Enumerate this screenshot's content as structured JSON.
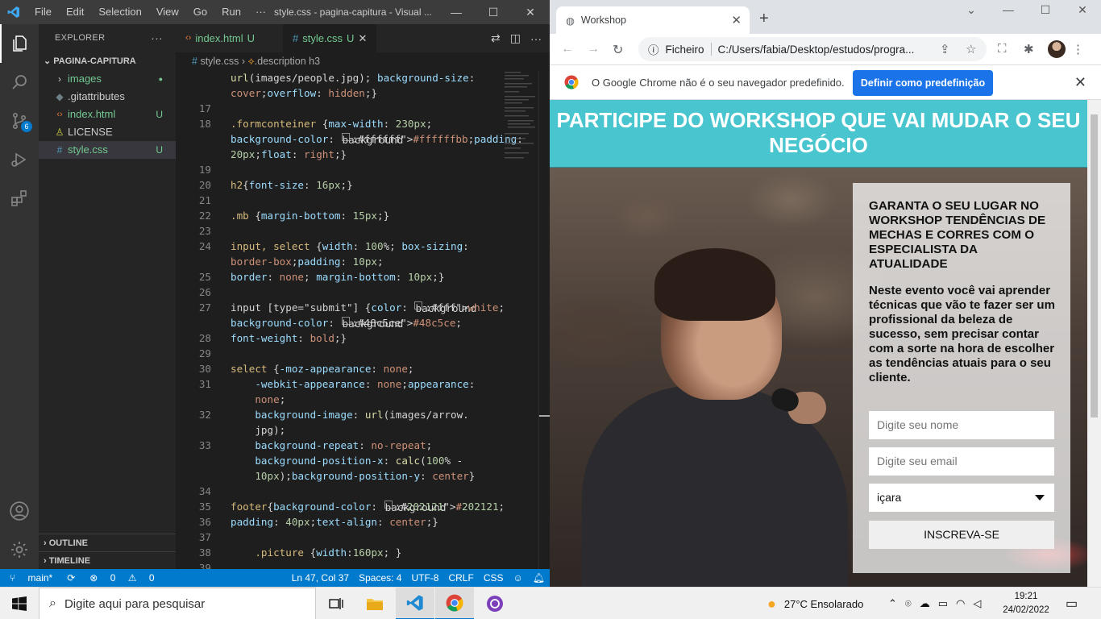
{
  "vscode": {
    "menu": [
      "File",
      "Edit",
      "Selection",
      "View",
      "Go",
      "Run",
      "···"
    ],
    "window_title": "style.css - pagina-capitura - Visual ...",
    "explorer": {
      "header": "EXPLORER",
      "folder": "PAGINA-CAPITURA",
      "items": [
        {
          "icon": "chevron-right",
          "label": "images",
          "status": "●"
        },
        {
          "icon": "gitattributes",
          "label": ".gitattributes",
          "status": ""
        },
        {
          "icon": "html",
          "label": "index.html",
          "status": "U"
        },
        {
          "icon": "license",
          "label": "LICENSE",
          "status": ""
        },
        {
          "icon": "css",
          "label": "style.css",
          "status": "U"
        }
      ],
      "outline": "OUTLINE",
      "timeline": "TIMELINE"
    },
    "scm_badge": "6",
    "tabs": [
      {
        "label": "index.html",
        "status": "U"
      },
      {
        "label": "style.css",
        "status": "U"
      }
    ],
    "breadcrumb": {
      "file": "style.css",
      "symbol": ".description h3"
    },
    "code_lines": [
      {
        "n": "",
        "text": "url(images/people.jpg); background-size:"
      },
      {
        "n": "",
        "text": "cover;overflow: hidden;}"
      },
      {
        "n": "17",
        "text": ""
      },
      {
        "n": "18",
        "text": ".formconteiner {max-width: 230px;"
      },
      {
        "n": "",
        "text": "background-color: #ffffffbb;padding:"
      },
      {
        "n": "",
        "text": "20px;float: right;}"
      },
      {
        "n": "19",
        "text": ""
      },
      {
        "n": "20",
        "text": "h2{font-size: 16px;}"
      },
      {
        "n": "21",
        "text": ""
      },
      {
        "n": "22",
        "text": ".mb {margin-bottom: 15px;}"
      },
      {
        "n": "23",
        "text": ""
      },
      {
        "n": "24",
        "text": "input, select {width: 100%; box-sizing:"
      },
      {
        "n": "",
        "text": "border-box;padding: 10px;"
      },
      {
        "n": "25",
        "text": "border: none; margin-bottom: 10px;}"
      },
      {
        "n": "26",
        "text": ""
      },
      {
        "n": "27",
        "text": "input [type=\"submit\"] {color: white;"
      },
      {
        "n": "",
        "text": "background-color: #48c5ce;"
      },
      {
        "n": "28",
        "text": "font-weight: bold;}"
      },
      {
        "n": "29",
        "text": ""
      },
      {
        "n": "30",
        "text": "select {-moz-appearance: none;"
      },
      {
        "n": "31",
        "text": "    -webkit-appearance: none;appearance:"
      },
      {
        "n": "",
        "text": "    none;"
      },
      {
        "n": "32",
        "text": "    background-image: url(images/arrow."
      },
      {
        "n": "",
        "text": "    jpg);"
      },
      {
        "n": "33",
        "text": "    background-repeat: no-repeat;"
      },
      {
        "n": "",
        "text": "    background-position-x: calc(100% -"
      },
      {
        "n": "",
        "text": "    10px);background-position-y: center}"
      },
      {
        "n": "34",
        "text": ""
      },
      {
        "n": "35",
        "text": "footer{background-color: #202121;"
      },
      {
        "n": "36",
        "text": "padding: 40px;text-align: center;}"
      },
      {
        "n": "37",
        "text": ""
      },
      {
        "n": "38",
        "text": "    .picture {width:160px; }"
      },
      {
        "n": "39",
        "text": ""
      }
    ],
    "status": {
      "branch": "main*",
      "errors": "0",
      "warnings": "0",
      "cursor": "Ln 47, Col 37",
      "spaces": "Spaces: 4",
      "encoding": "UTF-8",
      "eol": "CRLF",
      "language": "CSS"
    }
  },
  "chrome": {
    "tab_title": "Workshop",
    "omnibox": {
      "label": "Ficheiro",
      "url": "C:/Users/fabia/Desktop/estudos/progra..."
    },
    "infobar": {
      "message": "O Google Chrome não é o seu navegador predefinido.",
      "button": "Definir como predefinição"
    },
    "page": {
      "title": "PARTICIPE DO WORKSHOP QUE VAI MUDAR O SEU NEGÓCIO",
      "form_heading": "GARANTA O SEU LUGAR NO WORKSHOP TENDÊNCIAS DE MECHAS E CORRES COM O ESPECIALISTA DA ATUALIDADE",
      "description": "Neste evento você vai aprender técnicas que vão te fazer ser um profissional da beleza de sucesso, sem precisar contar com a sorte na hora de escolher as tendências atuais para o seu cliente.",
      "name_placeholder": "Digite seu nome",
      "email_placeholder": "Digite seu email",
      "city_selected": "içara",
      "submit": "INSCREVA-SE",
      "accent_color": "#48c5ce"
    }
  },
  "taskbar": {
    "search_placeholder": "Digite aqui para pesquisar",
    "weather": "27°C  Ensolarado",
    "time": "19:21",
    "date": "24/02/2022"
  }
}
